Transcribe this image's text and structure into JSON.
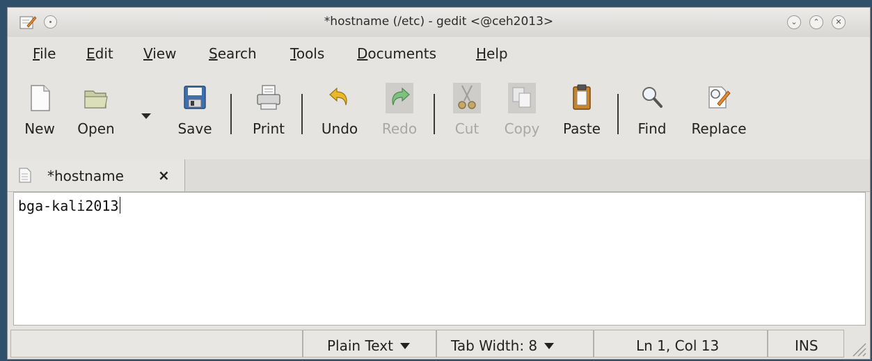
{
  "window": {
    "title": "*hostname (/etc) - gedit <@ceh2013>",
    "buttons": {
      "minimize": "⌄",
      "maximize": "⌃",
      "close": "✕"
    }
  },
  "menu": {
    "items": [
      {
        "mnemonic": "F",
        "rest": "ile"
      },
      {
        "mnemonic": "E",
        "rest": "dit"
      },
      {
        "mnemonic": "V",
        "rest": "iew"
      },
      {
        "mnemonic": "S",
        "rest": "earch"
      },
      {
        "mnemonic": "T",
        "rest": "ools"
      },
      {
        "mnemonic": "D",
        "rest": "ocuments"
      },
      {
        "mnemonic": "H",
        "rest": "elp"
      }
    ]
  },
  "toolbar": {
    "new": "New",
    "open": "Open",
    "save": "Save",
    "print": "Print",
    "undo": "Undo",
    "redo": "Redo",
    "cut": "Cut",
    "copy": "Copy",
    "paste": "Paste",
    "find": "Find",
    "replace": "Replace"
  },
  "tab": {
    "label": "*hostname",
    "close": "×"
  },
  "editor": {
    "content": "bga-kali2013"
  },
  "statusbar": {
    "language": "Plain Text",
    "tab_width_label": "Tab Width:",
    "tab_width_value": "8",
    "position": "Ln 1, Col 13",
    "mode": "INS"
  },
  "colors": {
    "window_bg": "#e6e4e1",
    "editor_bg": "#ffffff",
    "undo_icon": "#e9b92a",
    "redo_icon": "#4fae4f",
    "disabled_text": "#a9a7a4"
  }
}
